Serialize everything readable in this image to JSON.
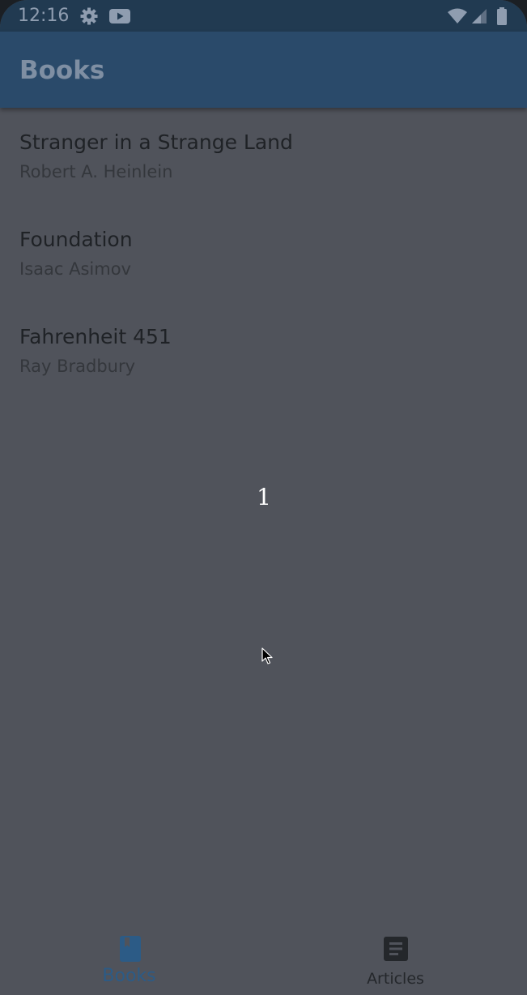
{
  "status_bar": {
    "time": "12:16",
    "icons": [
      "gear-icon",
      "youtube-icon",
      "wifi-icon",
      "signal-icon",
      "battery-icon"
    ]
  },
  "app_bar": {
    "title": "Books"
  },
  "books": [
    {
      "title": "Stranger in a Strange Land",
      "author": "Robert A. Heinlein"
    },
    {
      "title": "Foundation",
      "author": "Isaac Asimov"
    },
    {
      "title": "Fahrenheit 451",
      "author": "Ray Bradbury"
    }
  ],
  "overlay": {
    "number": "1"
  },
  "bottom_nav": {
    "items": [
      {
        "label": "Books",
        "icon": "book-icon",
        "selected": true
      },
      {
        "label": "Articles",
        "icon": "article-icon",
        "selected": false
      }
    ]
  },
  "colors": {
    "status_bar": "#213a51",
    "app_bar": "#2a4a6a",
    "background": "#50535b",
    "nav_selected": "#2c5b86",
    "nav_unselected": "#24272b"
  }
}
